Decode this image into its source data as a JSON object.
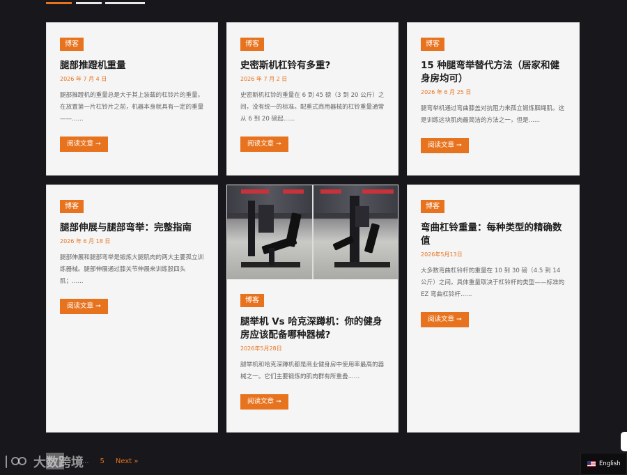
{
  "posts": [
    {
      "category": "博客",
      "title": "腿部推蹬机重量",
      "date": "2026 年 7 月 4 日",
      "excerpt": "腿部推蹬机的重量总是大于其上装载的杠铃片的重量。在放置第一片杠铃片之前，机器本身就具有一定的重量——......",
      "button": "阅读文章 ➞"
    },
    {
      "category": "博客",
      "title": "史密斯机杠铃有多重?",
      "date": "2026 年 7 月 2 日",
      "excerpt": "史密斯机杠铃的重量在 6 到 45 磅（3 到 20 公斤）之间，没有统一的标准。配重式商用器械的杠铃重量通常从 6 到 20 磅起......",
      "button": "阅读文章 ➞"
    },
    {
      "category": "博客",
      "title": "15 种腿弯举替代方法（居家和健身房均可）",
      "date": "2026 年 6 月 25 日",
      "excerpt": "腿弯举机通过弯曲膝盖对抗阻力来孤立锻炼腘绳肌。这是训练这块肌肉最简洁的方法之一，但是......",
      "button": "阅读文章 ➞"
    },
    {
      "category": "博客",
      "title": "腿部伸展与腿部弯举：完整指南",
      "date": "2026 年 6 月 18 日",
      "excerpt": "腿部伸展和腿部弯举是锻炼大腿肌肉的两大主要孤立训练器械。腿部伸展通过膝关节伸展来训练股四头肌；......",
      "button": "阅读文章 ➞"
    },
    {
      "category": "博客",
      "title": "腿举机 Vs 哈克深蹲机：你的健身房应该配备哪种器械?",
      "date": "2026年5月28日",
      "excerpt": "腿举机和哈克深蹲机都是商业健身房中使用率最高的器械之一。它们主要锻炼的肌肉群有所重叠......",
      "button": "阅读文章 ➞"
    },
    {
      "category": "博客",
      "title": "弯曲杠铃重量：每种类型的精确数值",
      "date": "2026年5月13日",
      "excerpt": "大多数弯曲杠铃杆的重量在 10 到 30 磅（4.5 到 14 公斤）之间。具体重量取决于杠铃杆的类型——标准的 EZ 弯曲杠铃杆......",
      "button": "阅读文章 ➞"
    }
  ],
  "pagination": {
    "dots": "...",
    "last_page": "5",
    "next": "Next »"
  },
  "watermark": {
    "text": "大数跨境"
  },
  "language": {
    "label": "English",
    "flag_icon": "us-flag-icon"
  },
  "colors": {
    "accent": "#e8731e",
    "background": "#18171b",
    "card": "#f5f5f5"
  }
}
